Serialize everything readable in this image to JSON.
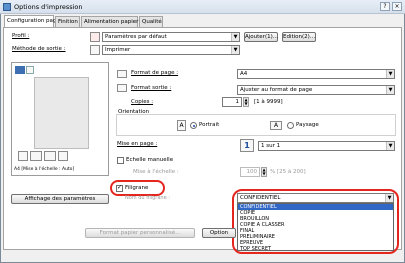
{
  "window": {
    "title": "Options d'impression"
  },
  "tabs": [
    "Configuration page",
    "Finition",
    "Alimentation papier",
    "Qualité"
  ],
  "left": {
    "profil_label": "Profil :",
    "profil_value": "Paramètres par défaut",
    "methode_label": "Méthode de sortie :",
    "methode_value": "Imprimer",
    "ajouter_label": "Ajouter(1)...",
    "edition_label": "Edition(2)...",
    "preview_caption": "A4 [Mise à l'échelle : Auto]",
    "params_button": "Affichage des paramètres"
  },
  "form": {
    "format_page_label": "Format de page :",
    "format_page_value": "A4",
    "format_sortie_label": "Format sortie :",
    "format_sortie_value": "Ajuster au format de page",
    "copies_label": "Copies :",
    "copies_value": "1",
    "copies_range": "[1 à 9999]",
    "orientation_label": "Orientation",
    "portrait_label": "Portrait",
    "paysage_label": "Paysage",
    "mise_en_page_label": "Mise en page :",
    "mise_en_page_value": "1 sur 1",
    "echelle_label": "Echelle manuelle",
    "mise_echelle_label": "Mise à l'échelle :",
    "mise_echelle_value": "100",
    "mise_echelle_range": "% [25 à 200]",
    "filigrane_label": "Filigrane",
    "filigrane_sub_label": "Nom du filigrane :",
    "filigrane_value": "CONFIDENTIEL"
  },
  "dropdown_options": [
    "CONFIDENTIEL",
    "COPIE",
    "BROUILLON",
    "COPIE A CLASSER",
    "FINAL",
    "PRELIMINAIRE",
    "EPREUVE",
    "TOP SECRET"
  ],
  "bottom": {
    "format_perso_button": "Format papier personnalisé...",
    "options_button": "Option"
  },
  "colors": {
    "highlight": "#e5261f",
    "selection": "#3168c6"
  }
}
